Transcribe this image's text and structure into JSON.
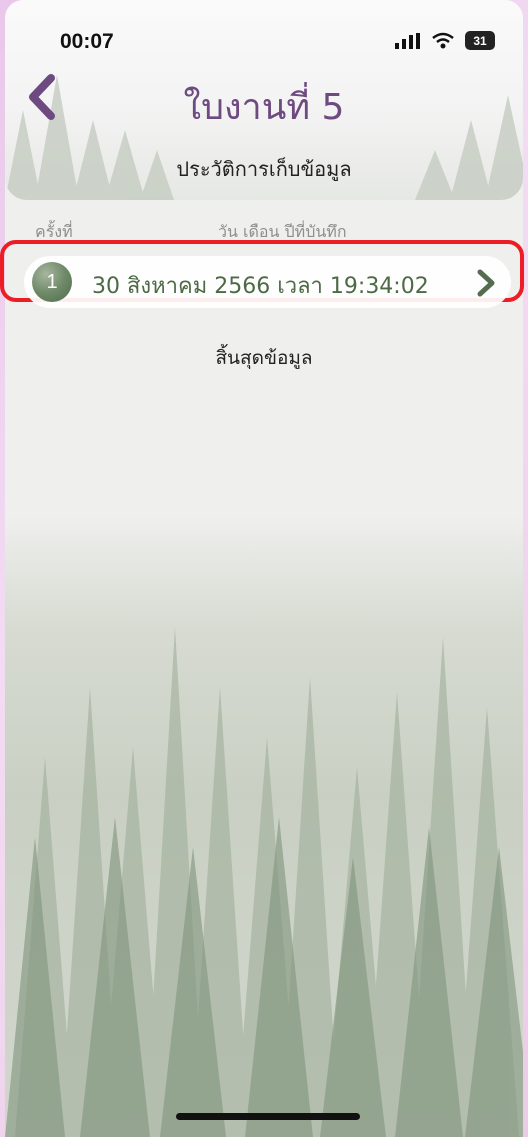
{
  "status": {
    "time": "00:07",
    "battery": "31",
    "signal_icon": "signal-icon",
    "wifi_icon": "wifi-icon"
  },
  "header": {
    "title": "ใบงานที่ 5",
    "subtitle": "ประวัติการเก็บข้อมูล",
    "back_icon": "chevron-left-icon"
  },
  "table": {
    "columns": [
      "ครั้งที่",
      "วัน เดือน ปีที่บันทึก"
    ],
    "rows": [
      {
        "index": "1",
        "text": "30 สิงหาคม 2566 เวลา 19:34:02"
      }
    ],
    "end_text": "สิ้นสุดข้อมูล"
  },
  "colors": {
    "accent_purple": "#6d4a7f",
    "row_green": "#4e6a45",
    "highlight_red": "#ec1d24"
  }
}
